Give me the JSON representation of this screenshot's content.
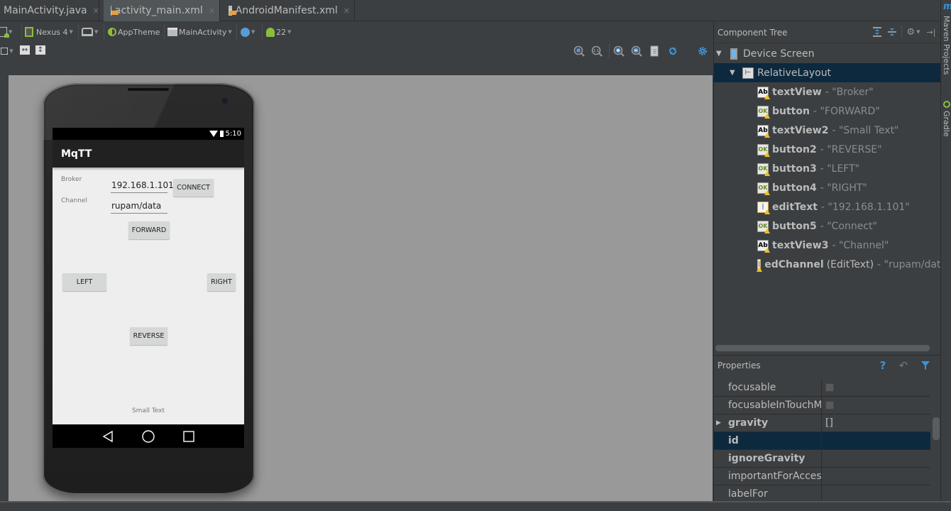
{
  "tabs": [
    {
      "label": "MainActivity.java",
      "icon": "java-class-icon",
      "active": false
    },
    {
      "label": "activity_main.xml",
      "icon": "xml-layout-icon",
      "active": true
    },
    {
      "label": "AndroidManifest.xml",
      "icon": "xml-manifest-icon",
      "active": false
    }
  ],
  "toolbar": {
    "device": "Nexus 4",
    "theme": "AppTheme",
    "activity": "MainActivity",
    "api_level": "22"
  },
  "zoom_toolbar": {
    "icons": [
      "zoom-to-fit-icon",
      "zoom-actual-icon",
      "zoom-in-icon",
      "zoom-out-icon",
      "preview-document-icon",
      "refresh-icon",
      "settings-icon"
    ]
  },
  "phone": {
    "status_time": "5:10",
    "app_title": "MqTT",
    "broker_label": "Broker",
    "broker_value": "192.168.1.101",
    "channel_label": "Channel",
    "channel_value": "rupam/data",
    "connect_btn": "CONNECT",
    "forward_btn": "FORWARD",
    "left_btn": "LEFT",
    "right_btn": "RIGHT",
    "reverse_btn": "REVERSE",
    "small_text": "Small Text"
  },
  "component_tree": {
    "title": "Component Tree",
    "root": "Device Screen",
    "layout": "RelativeLayout",
    "items": [
      {
        "name": "textView",
        "type": "",
        "value": "- \"Broker\"",
        "icon": "ab"
      },
      {
        "name": "button",
        "type": "",
        "value": "- \"FORWARD\"",
        "icon": "ok"
      },
      {
        "name": "textView2",
        "type": "",
        "value": "- \"Small Text\"",
        "icon": "ab"
      },
      {
        "name": "button2",
        "type": "",
        "value": "- \"REVERSE\"",
        "icon": "ok"
      },
      {
        "name": "button3",
        "type": "",
        "value": "- \"LEFT\"",
        "icon": "ok"
      },
      {
        "name": "button4",
        "type": "",
        "value": "- \"RIGHT\"",
        "icon": "ok"
      },
      {
        "name": "editText",
        "type": "",
        "value": "- \"192.168.1.101\"",
        "icon": "ed"
      },
      {
        "name": "button5",
        "type": "",
        "value": "- \"Connect\"",
        "icon": "ok"
      },
      {
        "name": "textView3",
        "type": "",
        "value": "- \"Channel\"",
        "icon": "ab"
      },
      {
        "name": "edChannel",
        "type": "(EditText)",
        "value": "- \"rupam/data\"",
        "icon": "ed"
      }
    ]
  },
  "properties": {
    "title": "Properties",
    "rows": [
      {
        "name": "focusable",
        "value": "",
        "bold": false,
        "checkbox": true,
        "expand": false,
        "selected": false
      },
      {
        "name": "focusableInTouchMode",
        "value": "",
        "bold": false,
        "checkbox": true,
        "expand": false,
        "selected": false
      },
      {
        "name": "gravity",
        "value": "[]",
        "bold": true,
        "checkbox": false,
        "expand": true,
        "selected": false
      },
      {
        "name": "id",
        "value": "",
        "bold": true,
        "checkbox": false,
        "expand": false,
        "selected": true
      },
      {
        "name": "ignoreGravity",
        "value": "",
        "bold": true,
        "checkbox": false,
        "expand": false,
        "selected": false
      },
      {
        "name": "importantForAccessibility",
        "value": "",
        "bold": false,
        "checkbox": false,
        "expand": false,
        "selected": false
      },
      {
        "name": "labelFor",
        "value": "",
        "bold": false,
        "checkbox": false,
        "expand": false,
        "selected": false
      }
    ]
  },
  "side_tools": {
    "maven": "Maven Projects",
    "gradle": "Gradle"
  }
}
